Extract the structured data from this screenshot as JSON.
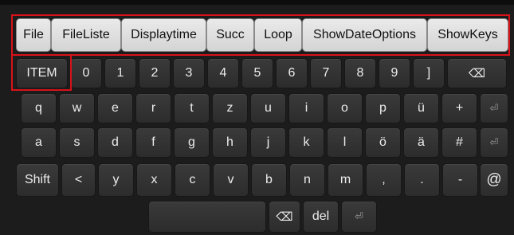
{
  "top_row": [
    {
      "label": "File"
    },
    {
      "label": "FileListe"
    },
    {
      "label": "Displaytime"
    },
    {
      "label": "Succ"
    },
    {
      "label": "Loop"
    },
    {
      "label": "ShowDateOptions"
    },
    {
      "label": "ShowKeys"
    }
  ],
  "row1": [
    "ITEM",
    "0",
    "1",
    "2",
    "3",
    "4",
    "5",
    "6",
    "7",
    "8",
    "9",
    "]",
    "⌫"
  ],
  "row2": [
    "q",
    "w",
    "e",
    "r",
    "t",
    "z",
    "u",
    "i",
    "o",
    "p",
    "ü",
    "+",
    "⏎"
  ],
  "row3": [
    "a",
    "s",
    "d",
    "f",
    "g",
    "h",
    "j",
    "k",
    "l",
    "ö",
    "ä",
    "#",
    "⏎"
  ],
  "row4": [
    "Shift",
    "<",
    "y",
    "x",
    "c",
    "v",
    "b",
    "n",
    "m",
    ",",
    ".",
    "-",
    "@"
  ],
  "row5": [
    "",
    "⌫",
    "del",
    "⏎"
  ],
  "highlight_color": "#d8121a"
}
